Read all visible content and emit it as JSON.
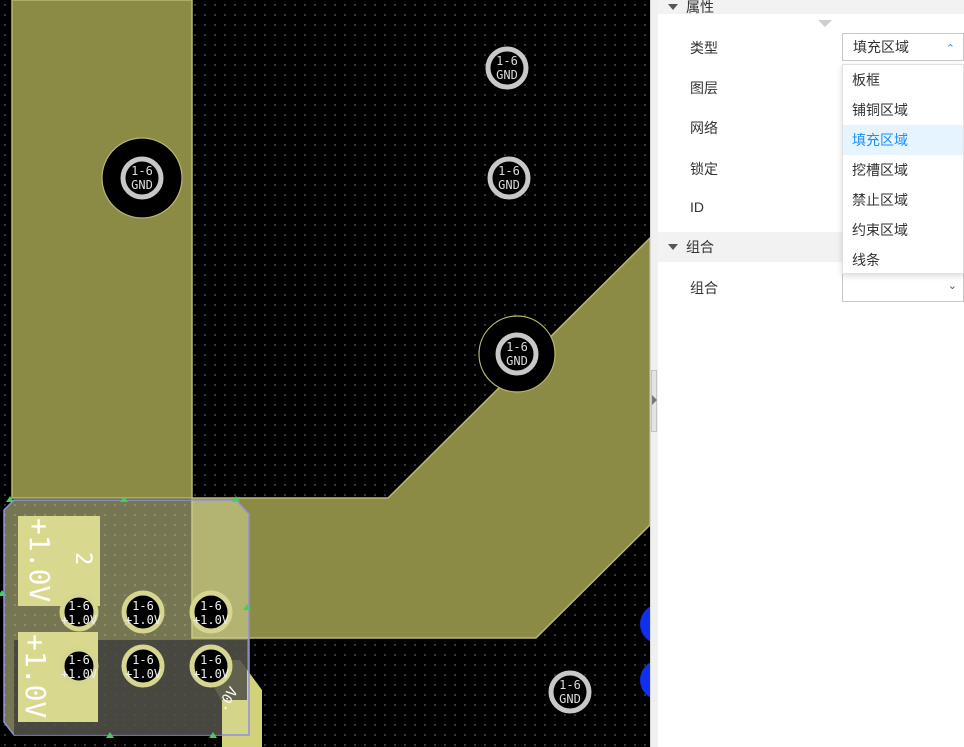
{
  "canvas": {
    "copper_color": "#8b8b46",
    "pads": [
      {
        "line1": "1-6",
        "line2": "GND"
      },
      {
        "line1": "1-6",
        "line2": "GND"
      },
      {
        "line1": "1-6",
        "line2": "GND"
      },
      {
        "line1": "1-6",
        "line2": "GND"
      },
      {
        "line1": "1-6",
        "line2": "GND"
      },
      {
        "line1": "1-6",
        "line2": "+1.0V"
      },
      {
        "line1": "1-6",
        "line2": "+1.0V"
      },
      {
        "line1": "1-6",
        "line2": "+1.0V"
      },
      {
        "line1": "1-6",
        "line2": "+1.0V"
      },
      {
        "line1": "1-6",
        "line2": "+1.0V"
      },
      {
        "line1": "1-6",
        "line2": "+1.0V"
      }
    ],
    "silkscreen": {
      "net_label_1": "+1.0V",
      "net_label_2": "+1.0V",
      "number": "2",
      "corner_label": ".0V"
    }
  },
  "panel": {
    "section_properties": "属性",
    "labels": {
      "type": "类型",
      "layer": "图层",
      "net": "网络",
      "lock": "锁定",
      "id": "ID",
      "group": "组合"
    },
    "section_group": "组合",
    "type_select": {
      "value": "填充区域",
      "options": [
        "板框",
        "铺铜区域",
        "填充区域",
        "挖槽区域",
        "禁止区域",
        "约束区域",
        "线条"
      ],
      "selected_index": 2
    },
    "group_select": {
      "value": ""
    }
  }
}
